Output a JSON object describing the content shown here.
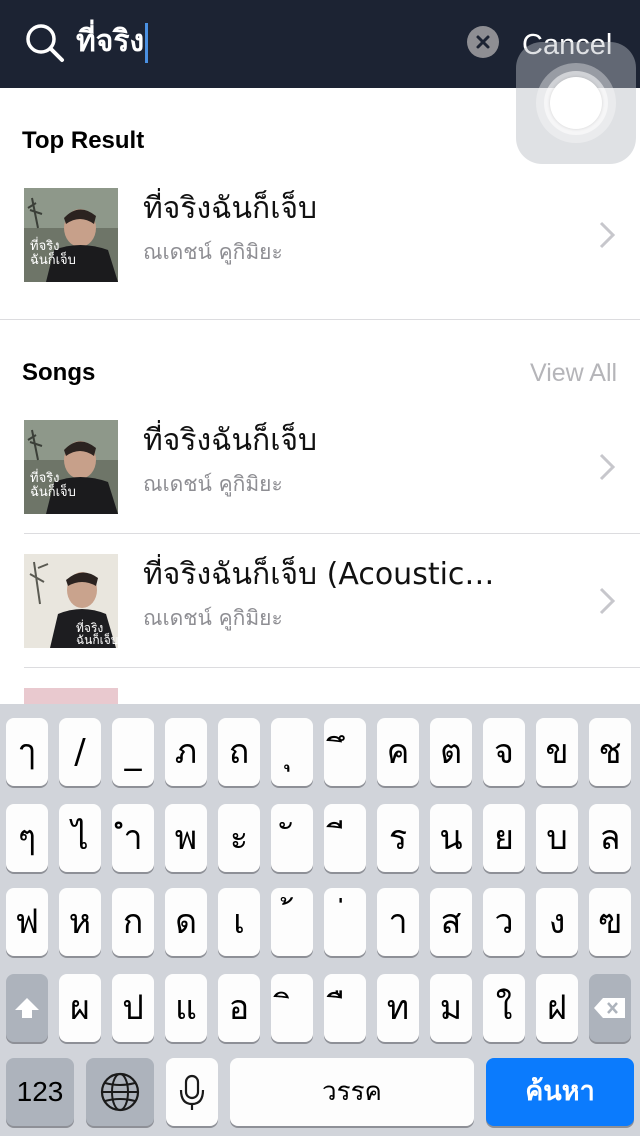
{
  "search": {
    "query": "ที่จริง",
    "cancel_label": "Cancel"
  },
  "top_result": {
    "section_title": "Top Result",
    "item": {
      "title": "ที่จริงฉันก็เจ็บ",
      "subtitle": "ณเดชน์ คูกิมิยะ"
    }
  },
  "songs": {
    "section_title": "Songs",
    "view_all_label": "View All",
    "items": [
      {
        "title": "ที่จริงฉันก็เจ็บ",
        "subtitle": "ณเดชน์ คูกิมิยะ"
      },
      {
        "title": "ที่จริงฉันก็เจ็บ (Acoustic…",
        "subtitle": "ณเดชน์ คูกิมิยะ"
      }
    ]
  },
  "keyboard": {
    "row1": [
      "ๅ",
      "/",
      "_",
      "ภ",
      "ถ",
      "ุ",
      "ึ",
      "ค",
      "ต",
      "จ",
      "ข",
      "ช"
    ],
    "row2": [
      "ๆ",
      "ไ",
      "ำ",
      "พ",
      "ะ",
      "ั",
      "ี",
      "ร",
      "น",
      "ย",
      "บ",
      "ล"
    ],
    "row3": [
      "ฟ",
      "ห",
      "ก",
      "ด",
      "เ",
      "้",
      "่",
      "า",
      "ส",
      "ว",
      "ง",
      "ฃ"
    ],
    "row4": [
      "ผ",
      "ป",
      "แ",
      "อ",
      "ิ",
      "ื",
      "ท",
      "ม",
      "ใ",
      "ฝ"
    ],
    "numbers_label": "123",
    "space_label": "วรรค",
    "search_label": "ค้นหา"
  },
  "colors": {
    "search_bar_bg": "#1c2333",
    "accent_blue": "#0b7bfd"
  },
  "icons": [
    "search-icon",
    "clear-icon",
    "chevron-right-icon",
    "shift-icon",
    "globe-icon",
    "microphone-icon",
    "backspace-icon"
  ]
}
